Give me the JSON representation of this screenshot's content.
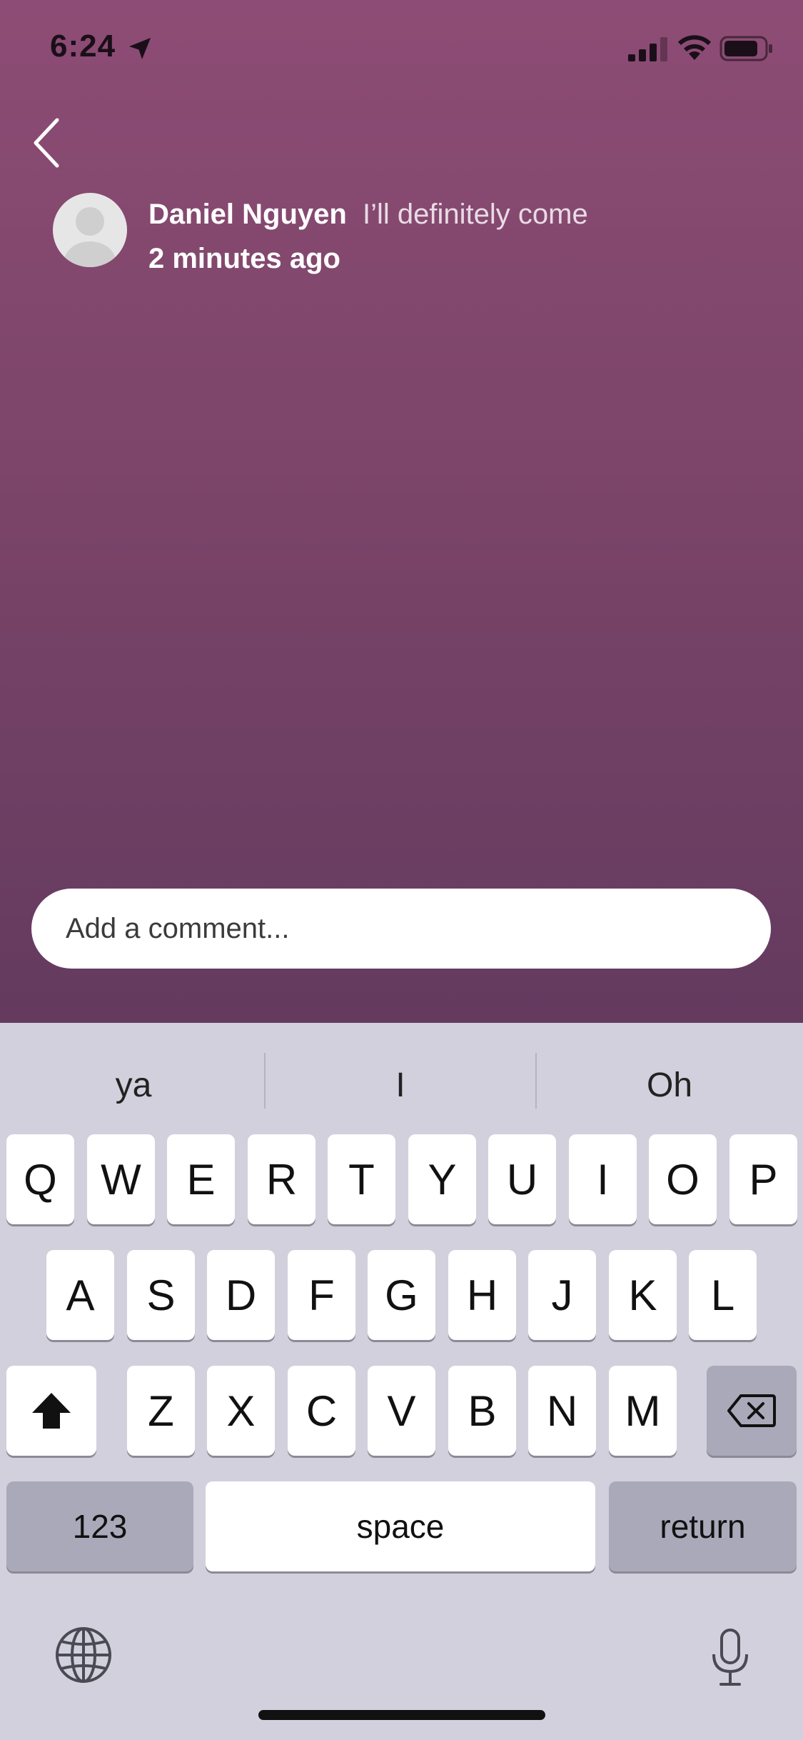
{
  "status_bar": {
    "time": "6:24"
  },
  "comment": {
    "author": "Daniel Nguyen",
    "text": "I’ll definitely come",
    "time_ago": "2 minutes ago"
  },
  "comment_input": {
    "placeholder": "Add a comment..."
  },
  "keyboard": {
    "suggestions": [
      "ya",
      "I",
      "Oh"
    ],
    "row1": [
      "Q",
      "W",
      "E",
      "R",
      "T",
      "Y",
      "U",
      "I",
      "O",
      "P"
    ],
    "row2": [
      "A",
      "S",
      "D",
      "F",
      "G",
      "H",
      "J",
      "K",
      "L"
    ],
    "row3": [
      "Z",
      "X",
      "C",
      "V",
      "B",
      "N",
      "M"
    ],
    "numbers_key": "123",
    "space_key": "space",
    "return_key": "return"
  },
  "colors": {
    "background_top": "#8d4c75",
    "background_bottom": "#643a5f",
    "keyboard_bg": "#d1d0dc"
  }
}
